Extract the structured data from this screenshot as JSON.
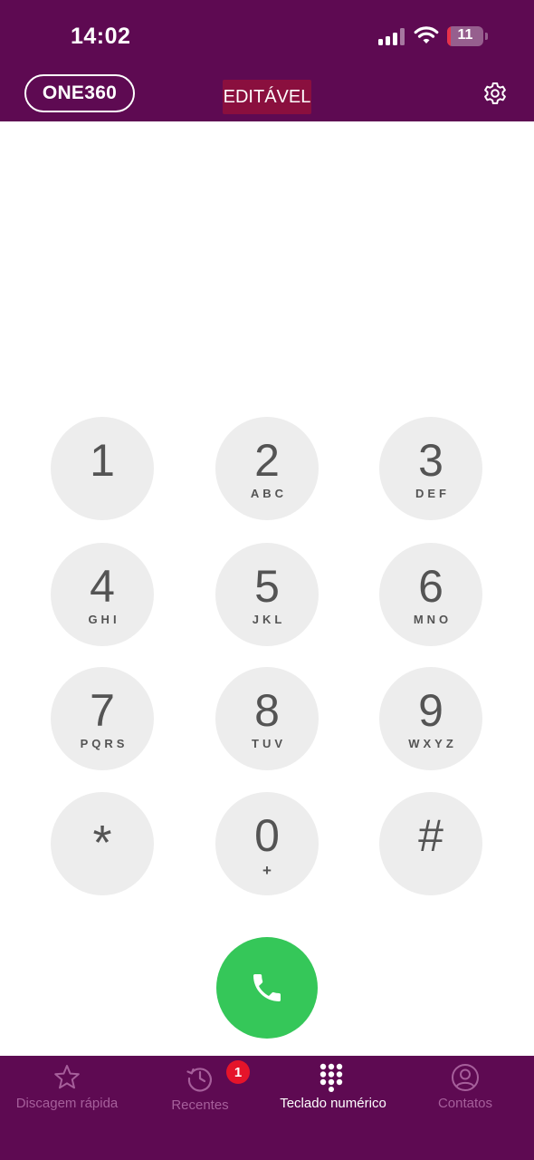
{
  "status_bar": {
    "time": "14:02",
    "battery_level": "11"
  },
  "header": {
    "brand_label": "ONE360",
    "mode_badge": "EDITÁVEL",
    "settings_icon": "gear-icon"
  },
  "keypad": {
    "keys": [
      {
        "digit": "1",
        "letters": ""
      },
      {
        "digit": "2",
        "letters": "ABC"
      },
      {
        "digit": "3",
        "letters": "DEF"
      },
      {
        "digit": "4",
        "letters": "GHI"
      },
      {
        "digit": "5",
        "letters": "JKL"
      },
      {
        "digit": "6",
        "letters": "MNO"
      },
      {
        "digit": "7",
        "letters": "PQRS"
      },
      {
        "digit": "8",
        "letters": "TUV"
      },
      {
        "digit": "9",
        "letters": "WXYZ"
      },
      {
        "digit": "*",
        "letters": ""
      },
      {
        "digit": "0",
        "letters": "+"
      },
      {
        "digit": "#",
        "letters": ""
      }
    ],
    "call_icon": "phone-icon"
  },
  "tabbar": {
    "tabs": [
      {
        "label": "Discagem rápida",
        "icon": "star-icon",
        "active": false
      },
      {
        "label": "Recentes",
        "icon": "history-icon",
        "active": false,
        "badge": "1"
      },
      {
        "label": "Teclado numérico",
        "icon": "keypad-icon",
        "active": true
      },
      {
        "label": "Contatos",
        "icon": "contact-icon",
        "active": false
      }
    ]
  },
  "colors": {
    "header_bg": "#5e0a52",
    "badge_bg": "#8a0f3e",
    "call_green": "#35c759",
    "key_bg": "#ededed",
    "notif_red": "#e5142a"
  }
}
